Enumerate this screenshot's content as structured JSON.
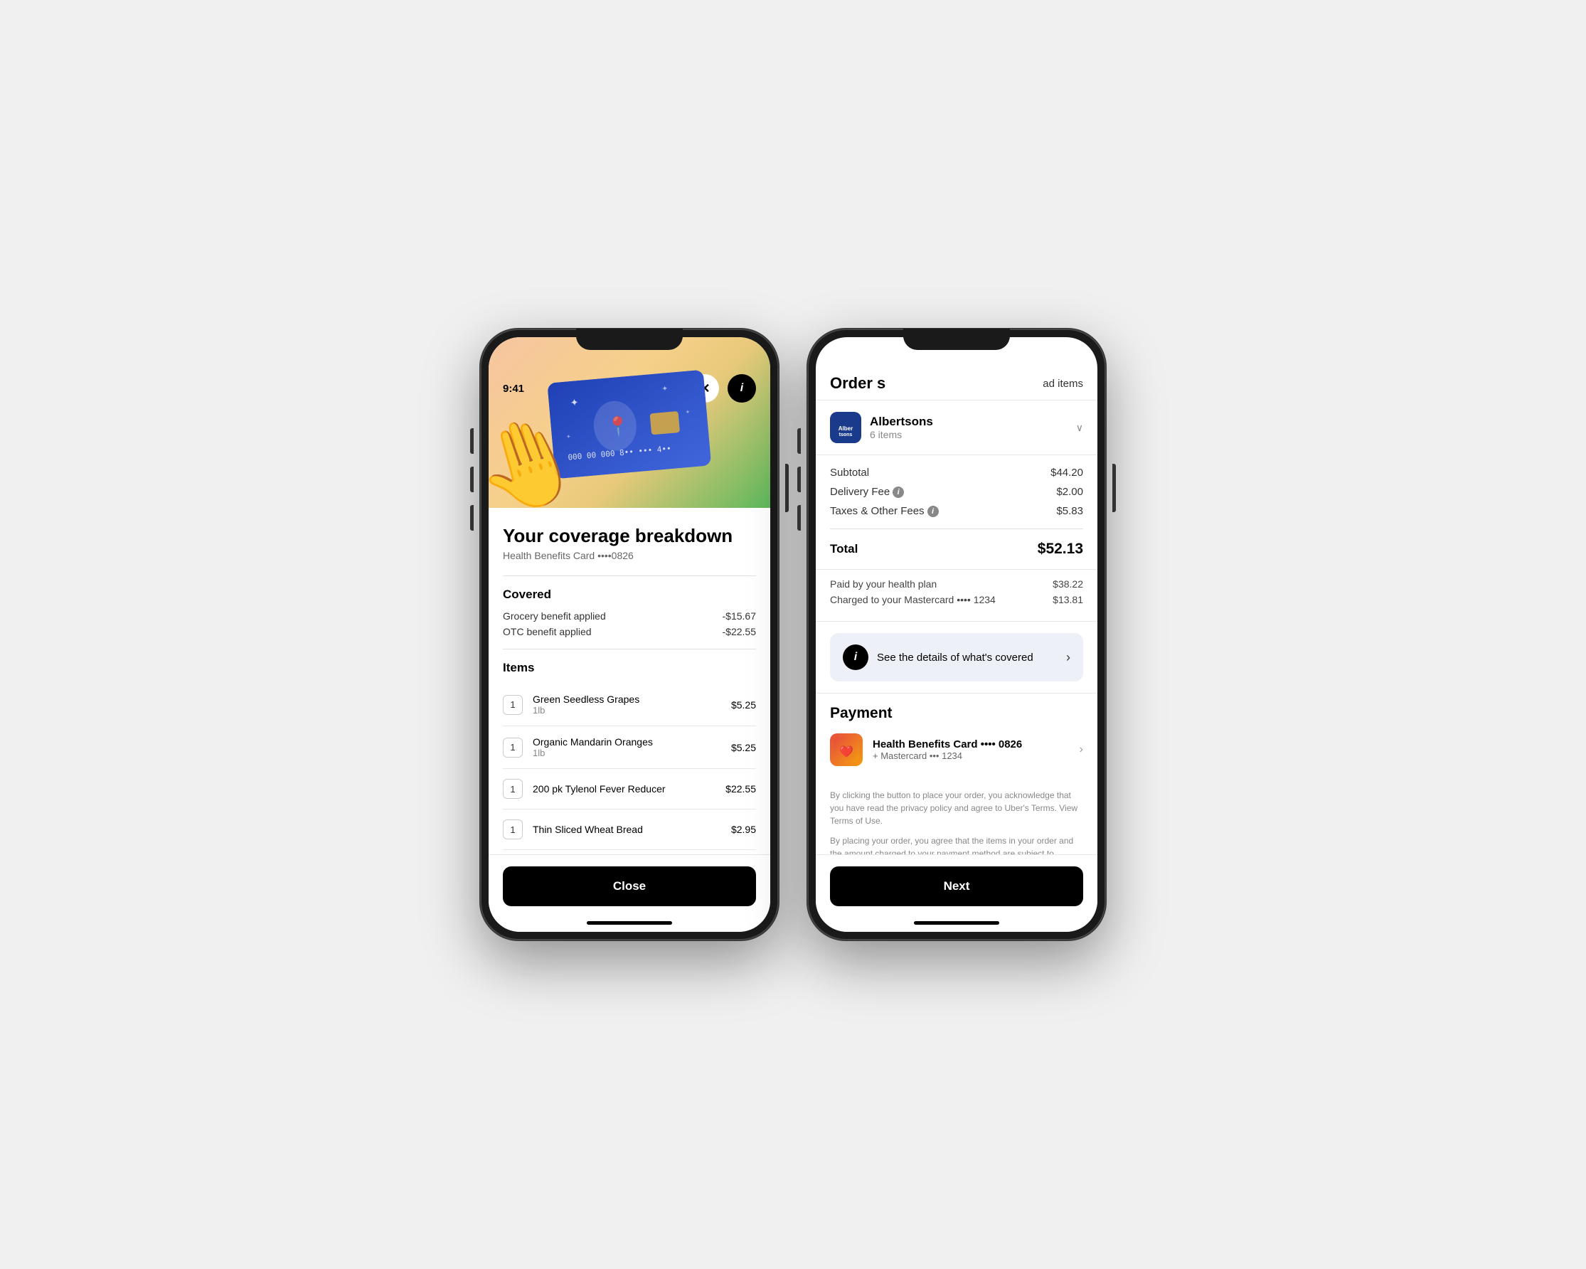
{
  "leftPhone": {
    "time": "9:41",
    "heroCard": "Health Benefits Card",
    "title": "Your coverage breakdown",
    "subtitle": "Health Benefits Card ••••0826",
    "covered": {
      "sectionLabel": "Covered",
      "items": [
        {
          "label": "Grocery benefit applied",
          "value": "-$15.67"
        },
        {
          "label": "OTC benefit applied",
          "value": "-$22.55"
        }
      ]
    },
    "itemsSection": {
      "sectionLabel": "Items",
      "items": [
        {
          "qty": "1",
          "name": "Green Seedless Grapes",
          "unit": "1lb",
          "price": "$5.25"
        },
        {
          "qty": "1",
          "name": "Organic Mandarin Oranges",
          "unit": "1lb",
          "price": "$5.25"
        },
        {
          "qty": "1",
          "name": "200 pk Tylenol Fever Reducer",
          "unit": "",
          "price": "$22.55"
        },
        {
          "qty": "1",
          "name": "Thin Sliced Wheat Bread",
          "unit": "",
          "price": "$2.95"
        }
      ]
    },
    "closeButton": "Close"
  },
  "rightPhone": {
    "topLeft": "Order s",
    "topRight": "ad items",
    "store": {
      "name": "Albertsons",
      "items": "6 items"
    },
    "fees": {
      "subtotal": {
        "label": "Subtotal",
        "value": "$44.20"
      },
      "deliveryFee": {
        "label": "Delivery Fee",
        "value": "$2.00"
      },
      "taxesFees": {
        "label": "Taxes & Other Fees",
        "value": "$5.83"
      },
      "total": {
        "label": "Total",
        "value": "$52.13"
      }
    },
    "paymentSplit": {
      "healthPlan": {
        "label": "Paid by your health plan",
        "value": "$38.22"
      },
      "mastercard": {
        "label": "Charged to your Mastercard •••• 1234",
        "value": "$13.81"
      }
    },
    "coverageBanner": "See the details of what's covered",
    "payment": {
      "title": "Payment",
      "cardName": "Health Benefits Card •••• 0826",
      "cardSub": "+ Mastercard ••• 1234"
    },
    "legalText1": "By clicking the button to place your order, you acknowledge that you have read the privacy policy and agree to Uber's Terms. View Terms of Use.",
    "legalText2": "By placing your order, you agree that the items in your order and the amount charged to your payment method are subject to change based on in-store item availability.",
    "nextButton": "Next"
  }
}
